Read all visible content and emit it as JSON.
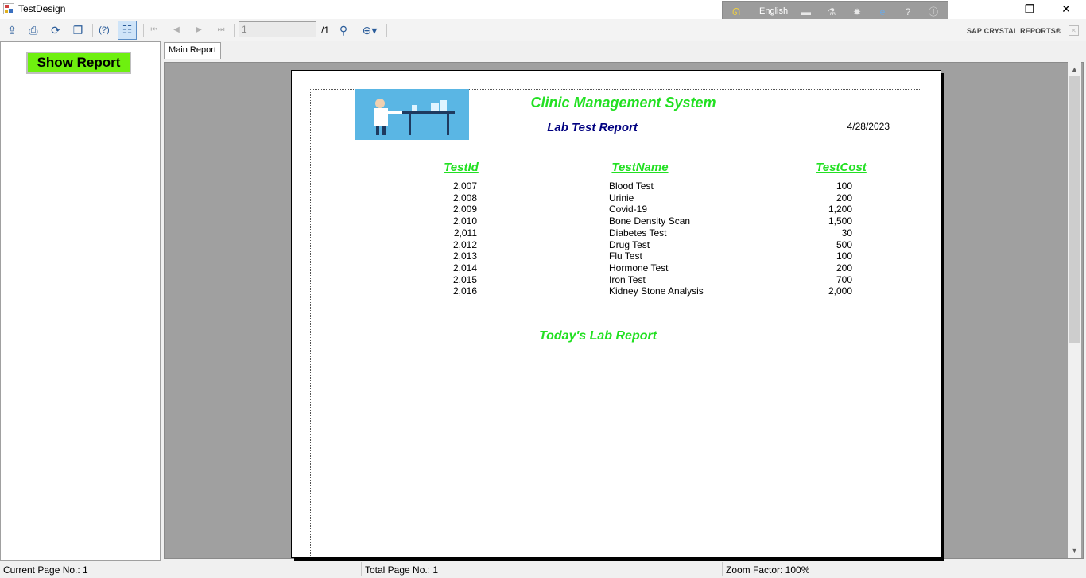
{
  "window": {
    "title": "TestDesign",
    "minimize": "—",
    "restore": "❐",
    "close": "✕"
  },
  "language_bar": {
    "language": "English"
  },
  "toolbar": {
    "page_input_value": "1",
    "page_total": "/1",
    "brand": "SAP CRYSTAL REPORTS®",
    "icons": [
      "export-icon",
      "print-icon",
      "refresh-icon",
      "copy-icon",
      "help-icon",
      "group-tree-icon",
      "first-page-icon",
      "prev-page-icon",
      "next-page-icon",
      "last-page-icon",
      "find-icon",
      "zoom-icon"
    ]
  },
  "left_panel": {
    "show_report_label": "Show Report"
  },
  "tabs": {
    "main_report": "Main Report"
  },
  "report": {
    "title": "Clinic Management System",
    "subtitle": "Lab Test Report",
    "date": "4/28/2023",
    "columns": {
      "id": "TestId",
      "name": "TestName",
      "cost": "TestCost"
    },
    "rows": [
      {
        "id": "2,007",
        "name": "Blood Test",
        "cost": "100"
      },
      {
        "id": "2,008",
        "name": "Urinie",
        "cost": "200"
      },
      {
        "id": "2,009",
        "name": "Covid-19",
        "cost": "1,200"
      },
      {
        "id": "2,010",
        "name": "Bone Density Scan",
        "cost": "1,500"
      },
      {
        "id": "2,011",
        "name": "Diabetes Test",
        "cost": "30"
      },
      {
        "id": "2,012",
        "name": "Drug Test",
        "cost": "500"
      },
      {
        "id": "2,013",
        "name": "Flu Test",
        "cost": "100"
      },
      {
        "id": "2,014",
        "name": "Hormone Test",
        "cost": "200"
      },
      {
        "id": "2,015",
        "name": "Iron Test",
        "cost": "700"
      },
      {
        "id": "2,016",
        "name": "Kidney Stone Analysis",
        "cost": "2,000"
      }
    ],
    "footer": "Today's Lab Report"
  },
  "status": {
    "current_page": "Current Page No.: 1",
    "total_page": "Total Page No.: 1",
    "zoom": "Zoom Factor: 100%"
  },
  "colors": {
    "accent_green": "#22e022",
    "button_green": "#6ef00f",
    "subtitle_navy": "#000080"
  }
}
